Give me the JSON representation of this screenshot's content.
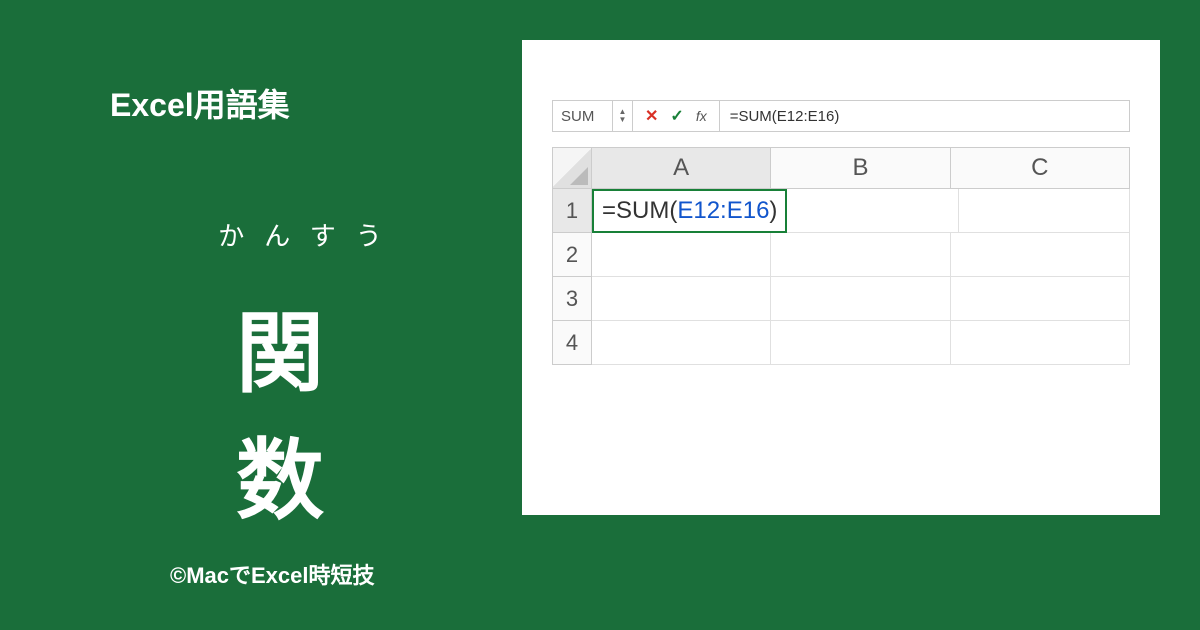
{
  "left": {
    "title": "Excel用語集",
    "reading": "かんすう",
    "kanji": "関　数"
  },
  "copyright": "©MacでExcel時短技",
  "excel": {
    "name_box": "SUM",
    "formula_bar": "=SUM(E12:E16)",
    "columns": [
      "A",
      "B",
      "C"
    ],
    "rows": [
      "1",
      "2",
      "3",
      "4"
    ],
    "cell_formula_prefix": "=SUM(",
    "cell_formula_ref": "E12:E16",
    "cell_formula_suffix": ")"
  }
}
